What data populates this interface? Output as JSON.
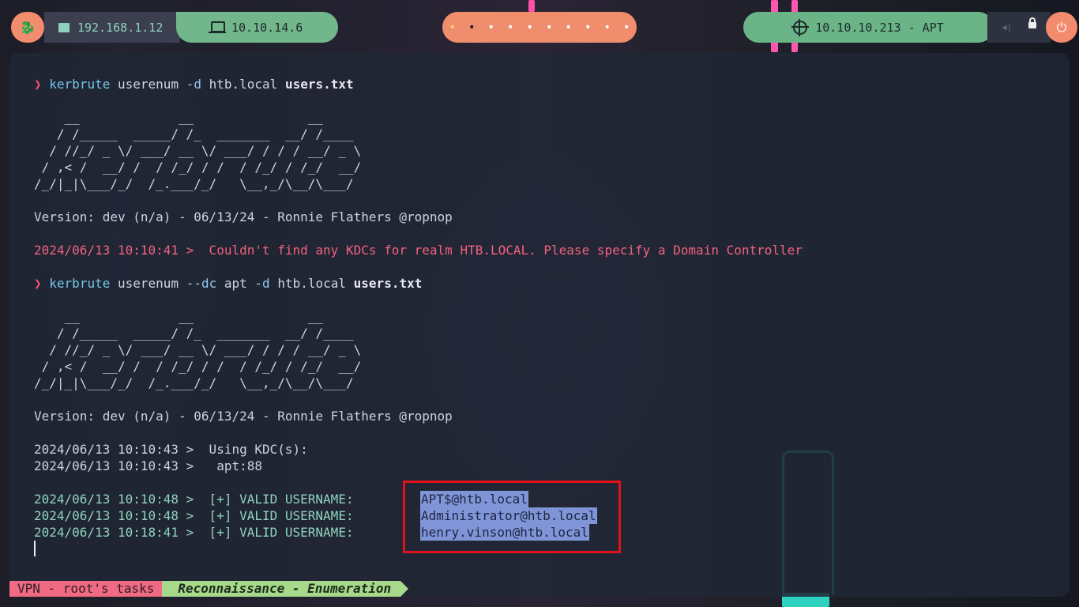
{
  "topbar": {
    "local_ip": "192.168.1.12",
    "vpn_ip": "10.10.14.6",
    "target": "10.10.10.213 - APT",
    "workspaces": [
      "•",
      "•",
      "•",
      "•",
      "•",
      "•",
      "•",
      "•",
      "•",
      "•"
    ]
  },
  "terminal": {
    "prompt_symbol": "❯",
    "cmd1": {
      "bin": "kerbrute",
      "sub": "userenum",
      "f1": "-d",
      "domain": "htb.local",
      "file": "users.txt"
    },
    "cmd2": {
      "bin": "kerbrute",
      "sub": "userenum",
      "f1": "--dc",
      "dc": "apt",
      "f2": "-d",
      "domain": "htb.local",
      "file": "users.txt"
    },
    "banner": [
      "    __             __               __     ",
      "   / /_____  _____/ /_  _______  __/ /____ ",
      "  / //_/ _ \\/ ___/ __ \\/ ___/ / / / __/ _ \\",
      " / ,< /  __/ /  / /_/ / /  / /_/ / /_/  __/",
      "/_/|_|\\___/_/  /_.___/_/   \\__,_/\\__/\\___/ "
    ],
    "version": "Version: dev (n/a) - 06/13/24 - Ronnie Flathers @ropnop",
    "error": "2024/06/13 10:10:41 >  Couldn't find any KDCs for realm HTB.LOCAL. Please specify a Domain Controller",
    "kdc1": "2024/06/13 10:10:43 >  Using KDC(s):",
    "kdc2": "2024/06/13 10:10:43 >   apt:88",
    "valid": [
      {
        "prefix": "2024/06/13 10:10:48 >  [+] VALID USERNAME:",
        "user": "APT$@htb.local"
      },
      {
        "prefix": "2024/06/13 10:10:48 >  [+] VALID USERNAME:",
        "user": "Administrator@htb.local"
      },
      {
        "prefix": "2024/06/13 10:18:41 >  [+] VALID USERNAME:",
        "user": "henry.vinson@htb.local"
      }
    ]
  },
  "statusline": {
    "session": "VPN - root's tasks",
    "window": "Reconnaissance - Enumeration"
  }
}
